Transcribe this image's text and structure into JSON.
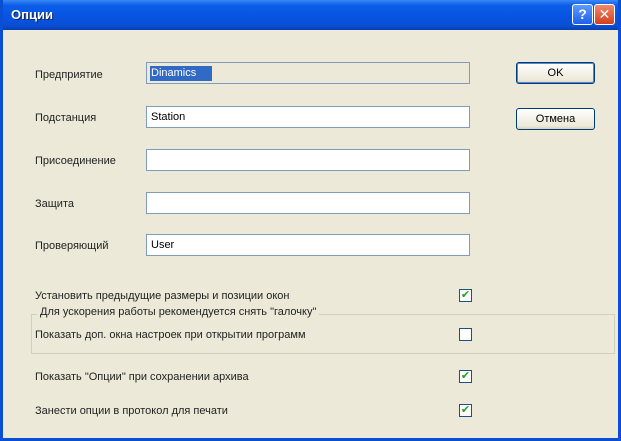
{
  "window": {
    "title": "Опции"
  },
  "titlebar": {
    "help": "?",
    "close": "✕"
  },
  "fields": {
    "enterprise": {
      "label": "Предприятие",
      "value": "Dinamics"
    },
    "substation": {
      "label": "Подстанция",
      "value": "Station"
    },
    "connection": {
      "label": "Присоединение",
      "value": ""
    },
    "protection": {
      "label": "Защита",
      "value": ""
    },
    "inspector": {
      "label": "Проверяющий",
      "value": "User"
    }
  },
  "buttons": {
    "ok": "OK",
    "cancel": "Отмена"
  },
  "options": {
    "restore_window_positions": {
      "label": "Установить предыдущие размеры и позиции окон",
      "checked": true,
      "mark": "✔"
    },
    "group_legend": "Для ускорения работы рекомендуется снять \"галочку\"",
    "show_settings_windows": {
      "label": "Показать доп. окна настроек при открытии программ",
      "checked": false,
      "mark": ""
    },
    "show_options_on_save": {
      "label": "Показать \"Опции\" при сохранении архива",
      "checked": true,
      "mark": "✔"
    },
    "add_options_to_print": {
      "label": "Занести опции в протокол для печати",
      "checked": true,
      "mark": "✔"
    }
  }
}
